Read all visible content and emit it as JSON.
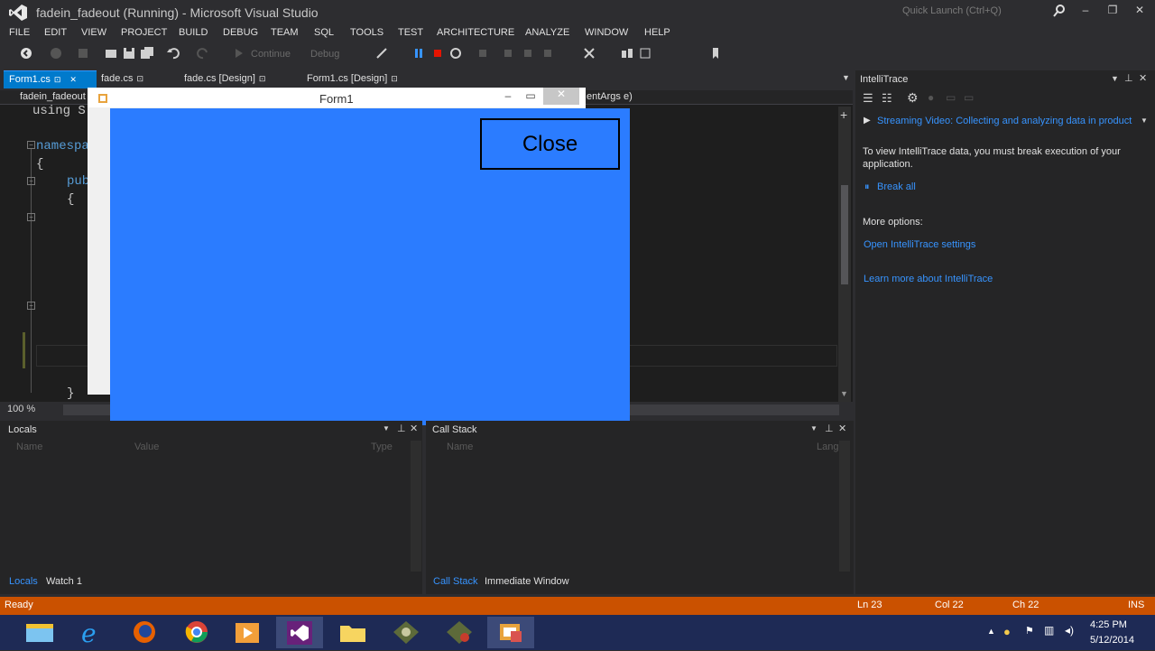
{
  "window": {
    "title": "fadein_fadeout (Running) - Microsoft Visual Studio",
    "quick_launch_placeholder": "Quick Launch (Ctrl+Q)",
    "minimize": "–",
    "restore": "❐",
    "close": "✕"
  },
  "menu": [
    "FILE",
    "EDIT",
    "VIEW",
    "PROJECT",
    "BUILD",
    "DEBUG",
    "TEAM",
    "SQL",
    "TOOLS",
    "TEST",
    "ARCHITECTURE",
    "ANALYZE",
    "WINDOW",
    "HELP"
  ],
  "toolbar": {
    "continue_label": "Continue",
    "config_label": "Debug"
  },
  "doc_tabs": [
    {
      "label": "Form1.cs"
    },
    {
      "label": "fade.cs"
    },
    {
      "label": "fade.cs [Design]"
    },
    {
      "label": "Form1.cs [Design]"
    }
  ],
  "editor": {
    "nav_left": "fadein_fadeout",
    "nav_right": "entArgs e)",
    "lines": {
      "using": "using S",
      "namespace": "namespa",
      "brace1": "{",
      "public": "pub",
      "brace2": "{",
      "brace_close": "}"
    },
    "zoom": "100 %"
  },
  "form": {
    "title": "Form1",
    "button_label": "Close",
    "client_color": "#2b7cff"
  },
  "intellitrace": {
    "title": "IntelliTrace",
    "stream_text": "Streaming Video: Collecting and analyzing data in product",
    "info": "To view IntelliTrace data, you must break execution of your application.",
    "break_all": "Break all",
    "more_options": "More options:",
    "open_settings": "Open IntelliTrace settings",
    "learn_more": "Learn more about IntelliTrace"
  },
  "locals": {
    "title": "Locals",
    "columns": [
      "Name",
      "Value",
      "Type"
    ],
    "tabs": [
      "Locals",
      "Watch 1"
    ]
  },
  "callstack": {
    "title": "Call Stack",
    "columns": [
      "Name",
      "Lang"
    ],
    "tabs": [
      "Call Stack",
      "Immediate Window"
    ]
  },
  "status": {
    "ready": "Ready",
    "ln": "Ln 23",
    "col": "Col 22",
    "ch": "Ch 22",
    "ins": "INS",
    "bar_color": "#ca5100"
  },
  "taskbar": {
    "time": "4:25 PM",
    "date": "5/12/2014",
    "apps": [
      "file-explorer-icon",
      "internet-explorer-icon",
      "firefox-icon",
      "chrome-icon",
      "media-player-icon",
      "visual-studio-icon",
      "folder-icon",
      "app-icon-1",
      "app-icon-2",
      "form-app-icon"
    ]
  }
}
